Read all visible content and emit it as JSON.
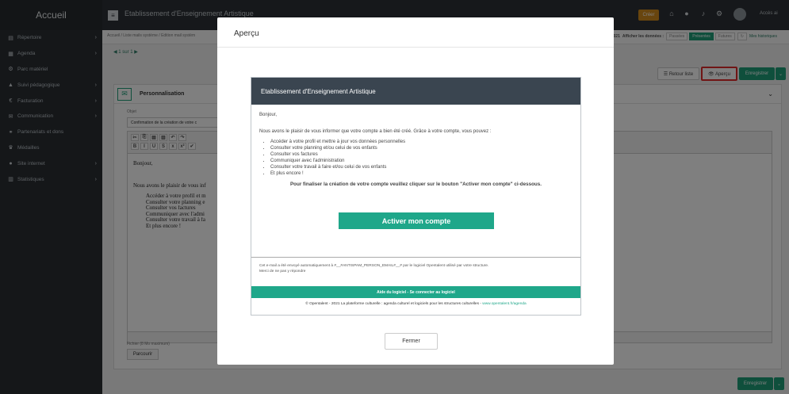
{
  "sidebar": {
    "brand": "Accueil",
    "items": [
      {
        "icon": "address-book-icon",
        "glyph": "▤",
        "label": "Répertoire",
        "chevron": true
      },
      {
        "icon": "calendar-icon",
        "glyph": "▦",
        "label": "Agenda",
        "chevron": true
      },
      {
        "icon": "tools-icon",
        "glyph": "⚙",
        "label": "Parc matériel",
        "chevron": false
      },
      {
        "icon": "graduation-cap-icon",
        "glyph": "▲",
        "label": "Suivi pédagogique",
        "chevron": true
      },
      {
        "icon": "euro-icon",
        "glyph": "€",
        "label": "Facturation",
        "chevron": true
      },
      {
        "icon": "comments-icon",
        "glyph": "✉",
        "label": "Communication",
        "chevron": true
      },
      {
        "icon": "handshake-icon",
        "glyph": "⚭",
        "label": "Partenariats et dons",
        "chevron": false
      },
      {
        "icon": "trophy-icon",
        "glyph": "♛",
        "label": "Médailles",
        "chevron": false
      },
      {
        "icon": "globe-icon",
        "glyph": "●",
        "label": "Site internet",
        "chevron": true
      },
      {
        "icon": "chart-icon",
        "glyph": "▥",
        "label": "Statistiques",
        "chevron": true
      }
    ]
  },
  "topbar": {
    "title": "Etablissement d'Enseignement Artistique",
    "create_label": "Créer",
    "access_label": "Accès ai"
  },
  "breadcrumb": {
    "path": "Accueil / Liste mails système / Edition mail systèm",
    "year": "20 / 2021",
    "show_data_label": "Afficher les données :",
    "filters": [
      "Passées",
      "Présentes",
      "Futures"
    ],
    "active_filter": "Présentes",
    "history_label": "Mes historiques"
  },
  "pager": "◀ 1 sur 1 ▶",
  "actions": {
    "retour_label": "☰ Retour liste",
    "apercu_label": "👁 Aperçu",
    "save_label": "Enregistrer",
    "caret": "⌄"
  },
  "panel": {
    "title": "Personnalisation",
    "object_label": "Objet",
    "object_value": "Confirmation de la création de votre c",
    "editor_text": {
      "greeting": "Bonjour,",
      "intro": "Nous avons le plaisir de vous inf",
      "items": [
        "Accéder à votre profil et m",
        "Consulter votre planning e",
        "Consulter vos factures",
        "Communiquer avec l'admi",
        "Consulter votre travail à fa",
        "Et plus encore !"
      ]
    },
    "file_label": "Fichier (8 Mo maximum)",
    "browse_label": "Parcourir"
  },
  "modal": {
    "title": "Aperçu",
    "email": {
      "header": "Etablissement d'Enseignement Artistique",
      "greeting": "Bonjour,",
      "intro": "Nous avons le plaisir de vous informer que votre compte a bien été créé. Grâce à votre compte, vous pouvez :",
      "items": [
        "Accéder à votre profil et mettre à jour vos données personnelles",
        "Consulter votre planning et/ou celui de vos enfants",
        "Consulter vos factures",
        "Communiquer avec l'administration",
        "Consulter votre travail à faire et/ou celui de vos enfants",
        "Et plus encore !"
      ],
      "finalize": "Pour finaliser la création de votre compte veuillez cliquer sur le bouton \"Activer mon compte\" ci-dessous.",
      "activate_label": "Activer mon compte",
      "auto_line1": "Cet e-mail a été envoyé automatiquement à #__#ANTISPAM_PERSON_EMAIL#__# par le logiciel Opentalent utilisé par votre structure.",
      "auto_line2": "Merci de ne pas y répondre",
      "help_bar": "Aide du logiciel - Se connecter au logiciel",
      "copyright": "© Opentalent - 2021 La plateforme culturelle : agenda culturel et logiciels pour les structures culturelles - ",
      "copyright_link": "www.opentalent.fr/agenda"
    },
    "close_label": "Fermer"
  }
}
